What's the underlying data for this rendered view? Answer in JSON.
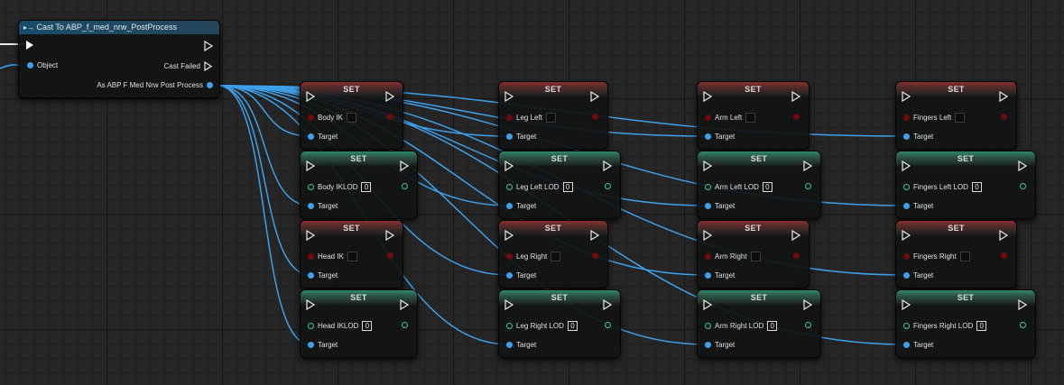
{
  "cast_node": {
    "title": "Cast To ABP_f_med_nrw_PostProcess",
    "title_icon": "exec-cast-icon",
    "object_label": "Object",
    "cast_failed_label": "Cast Failed",
    "output_label": "As ABP F Med Nrw Post Process"
  },
  "set_header": "SET",
  "target_label": "Target",
  "set_nodes": [
    {
      "id": "body-ik",
      "kind": "bool",
      "label": "Body IK",
      "value": ""
    },
    {
      "id": "body-iklod",
      "kind": "int",
      "label": "Body IKLOD",
      "value": "0"
    },
    {
      "id": "head-ik",
      "kind": "bool",
      "label": "Head IK",
      "value": ""
    },
    {
      "id": "head-iklod",
      "kind": "int",
      "label": "Head IKLOD",
      "value": "0"
    },
    {
      "id": "leg-left",
      "kind": "bool",
      "label": "Leg Left",
      "value": ""
    },
    {
      "id": "leg-left-lod",
      "kind": "int",
      "label": "Leg Left LOD",
      "value": "0"
    },
    {
      "id": "leg-right",
      "kind": "bool",
      "label": "Leg Right",
      "value": ""
    },
    {
      "id": "leg-right-lod",
      "kind": "int",
      "label": "Leg Right LOD",
      "value": "0"
    },
    {
      "id": "arm-left",
      "kind": "bool",
      "label": "Arm Left",
      "value": ""
    },
    {
      "id": "arm-left-lod",
      "kind": "int",
      "label": "Arm Left LOD",
      "value": "0"
    },
    {
      "id": "arm-right",
      "kind": "bool",
      "label": "Arm Right",
      "value": ""
    },
    {
      "id": "arm-right-lod",
      "kind": "int",
      "label": "Arm Right LOD",
      "value": "0"
    },
    {
      "id": "fingers-left",
      "kind": "bool",
      "label": "Fingers Left",
      "value": ""
    },
    {
      "id": "fingers-left-lod",
      "kind": "int",
      "label": "Fingers Left LOD",
      "value": "0"
    },
    {
      "id": "fingers-right",
      "kind": "bool",
      "label": "Fingers Right",
      "value": ""
    },
    {
      "id": "fingers-right-lod",
      "kind": "int",
      "label": "Fingers Right LOD",
      "value": "0"
    }
  ],
  "colors": {
    "object_wire": "#3ea0e8",
    "bool_pin": "#6e0b0b",
    "int_pin": "#3dc99a",
    "exec_pin": "#ffffff",
    "set_bool_header": "#8c2f2f",
    "set_int_header": "#2f8a6c"
  }
}
